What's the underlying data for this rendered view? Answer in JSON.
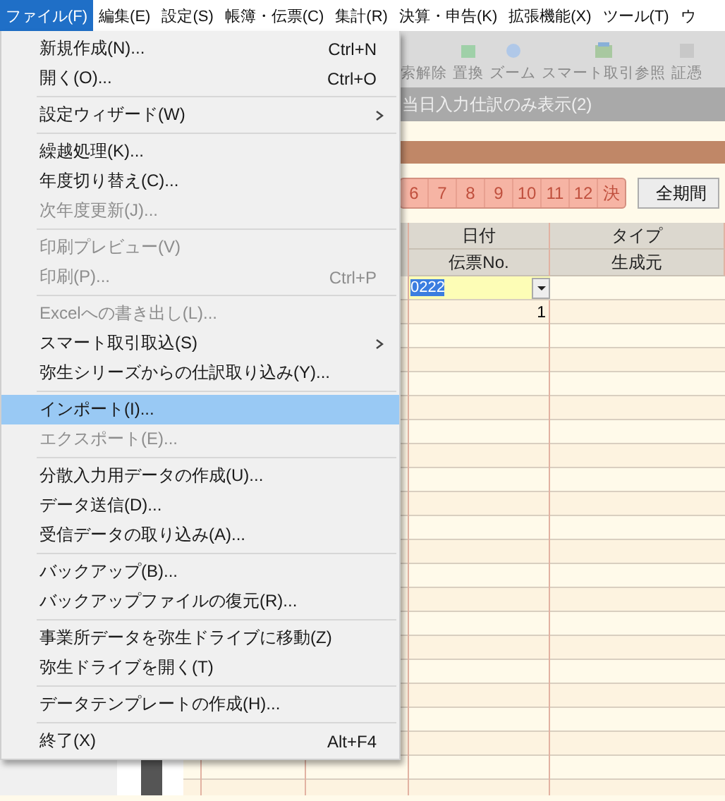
{
  "menubar": {
    "items": [
      {
        "label": "ファイル(F)",
        "selected": true
      },
      {
        "label": "編集(E)",
        "selected": false
      },
      {
        "label": "設定(S)",
        "selected": false
      },
      {
        "label": "帳簿・伝票(C)",
        "selected": false
      },
      {
        "label": "集計(R)",
        "selected": false
      },
      {
        "label": "決算・申告(K)",
        "selected": false
      },
      {
        "label": "拡張機能(X)",
        "selected": false
      },
      {
        "label": "ツール(T)",
        "selected": false
      },
      {
        "label": "ウ",
        "selected": false
      }
    ]
  },
  "file_menu": {
    "groups": [
      [
        {
          "label": "新規作成(N)...",
          "shortcut": "Ctrl+N",
          "disabled": false,
          "submenu": false,
          "selected": false
        },
        {
          "label": "開く(O)...",
          "shortcut": "Ctrl+O",
          "disabled": false,
          "submenu": false,
          "selected": false
        }
      ],
      [
        {
          "label": "設定ウィザード(W)",
          "disabled": false,
          "submenu": true,
          "selected": false
        }
      ],
      [
        {
          "label": "繰越処理(K)...",
          "disabled": false,
          "submenu": false,
          "selected": false
        },
        {
          "label": "年度切り替え(C)...",
          "disabled": false,
          "submenu": false,
          "selected": false
        },
        {
          "label": "次年度更新(J)...",
          "disabled": true,
          "submenu": false,
          "selected": false
        }
      ],
      [
        {
          "label": "印刷プレビュー(V)",
          "disabled": true,
          "submenu": false,
          "selected": false
        },
        {
          "label": "印刷(P)...",
          "shortcut": "Ctrl+P",
          "disabled": true,
          "submenu": false,
          "selected": false
        }
      ],
      [
        {
          "label": "Excelへの書き出し(L)...",
          "disabled": true,
          "submenu": false,
          "selected": false
        },
        {
          "label": "スマート取引取込(S)",
          "disabled": false,
          "submenu": true,
          "selected": false
        },
        {
          "label": "弥生シリーズからの仕訳取り込み(Y)...",
          "disabled": false,
          "submenu": false,
          "selected": false
        }
      ],
      [
        {
          "label": "インポート(I)...",
          "disabled": false,
          "submenu": false,
          "selected": true
        },
        {
          "label": "エクスポート(E)...",
          "disabled": true,
          "submenu": false,
          "selected": false
        }
      ],
      [
        {
          "label": "分散入力用データの作成(U)...",
          "disabled": false,
          "submenu": false,
          "selected": false
        },
        {
          "label": "データ送信(D)...",
          "disabled": false,
          "submenu": false,
          "selected": false
        },
        {
          "label": "受信データの取り込み(A)...",
          "disabled": false,
          "submenu": false,
          "selected": false
        }
      ],
      [
        {
          "label": "バックアップ(B)...",
          "disabled": false,
          "submenu": false,
          "selected": false
        },
        {
          "label": "バックアップファイルの復元(R)...",
          "disabled": false,
          "submenu": false,
          "selected": false
        }
      ],
      [
        {
          "label": "事業所データを弥生ドライブに移動(Z)",
          "disabled": false,
          "submenu": false,
          "selected": false
        },
        {
          "label": "弥生ドライブを開く(T)",
          "disabled": false,
          "submenu": false,
          "selected": false
        }
      ],
      [
        {
          "label": "データテンプレートの作成(H)...",
          "disabled": false,
          "submenu": false,
          "selected": false
        }
      ],
      [
        {
          "label": "終了(X)",
          "shortcut": "Alt+F4",
          "disabled": false,
          "submenu": false,
          "selected": false
        }
      ]
    ]
  },
  "toolbar": {
    "buttons": [
      {
        "label": "索解除"
      },
      {
        "label": "置換"
      },
      {
        "label": "ズーム"
      },
      {
        "label": "スマート取引参照"
      },
      {
        "label": "証憑"
      }
    ]
  },
  "filter_bar": {
    "label": "当日入力仕訳のみ表示(2)"
  },
  "month_tabs": [
    {
      "label": "6",
      "selected": false
    },
    {
      "label": "7",
      "selected": false
    },
    {
      "label": "8",
      "selected": false
    },
    {
      "label": "9",
      "selected": false
    },
    {
      "label": "10",
      "selected": false
    },
    {
      "label": "11",
      "selected": false
    },
    {
      "label": "12",
      "selected": false
    },
    {
      "label": "決",
      "selected": false
    }
  ],
  "all_period_button": {
    "label": "全期間"
  },
  "table": {
    "columns": [
      {
        "top": "日付",
        "bottom": "伝票No."
      },
      {
        "top": "タイプ",
        "bottom": "生成元"
      }
    ],
    "entry": {
      "date": "0222",
      "voucher_no": "1"
    }
  }
}
